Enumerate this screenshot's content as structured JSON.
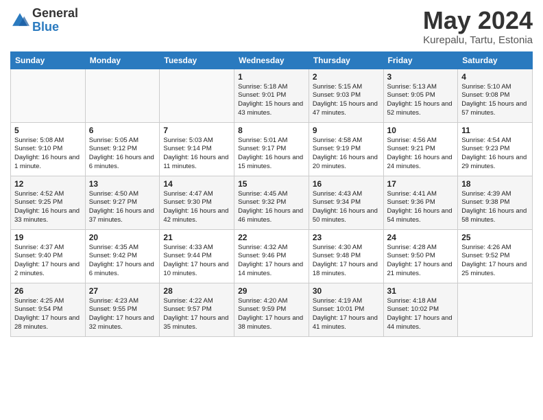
{
  "header": {
    "logo_general": "General",
    "logo_blue": "Blue",
    "title": "May 2024",
    "subtitle": "Kurepalu, Tartu, Estonia"
  },
  "days_of_week": [
    "Sunday",
    "Monday",
    "Tuesday",
    "Wednesday",
    "Thursday",
    "Friday",
    "Saturday"
  ],
  "weeks": [
    [
      {
        "num": "",
        "info": ""
      },
      {
        "num": "",
        "info": ""
      },
      {
        "num": "",
        "info": ""
      },
      {
        "num": "1",
        "info": "Sunrise: 5:18 AM\nSunset: 9:01 PM\nDaylight: 15 hours and 43 minutes."
      },
      {
        "num": "2",
        "info": "Sunrise: 5:15 AM\nSunset: 9:03 PM\nDaylight: 15 hours and 47 minutes."
      },
      {
        "num": "3",
        "info": "Sunrise: 5:13 AM\nSunset: 9:05 PM\nDaylight: 15 hours and 52 minutes."
      },
      {
        "num": "4",
        "info": "Sunrise: 5:10 AM\nSunset: 9:08 PM\nDaylight: 15 hours and 57 minutes."
      }
    ],
    [
      {
        "num": "5",
        "info": "Sunrise: 5:08 AM\nSunset: 9:10 PM\nDaylight: 16 hours and 1 minute."
      },
      {
        "num": "6",
        "info": "Sunrise: 5:05 AM\nSunset: 9:12 PM\nDaylight: 16 hours and 6 minutes."
      },
      {
        "num": "7",
        "info": "Sunrise: 5:03 AM\nSunset: 9:14 PM\nDaylight: 16 hours and 11 minutes."
      },
      {
        "num": "8",
        "info": "Sunrise: 5:01 AM\nSunset: 9:17 PM\nDaylight: 16 hours and 15 minutes."
      },
      {
        "num": "9",
        "info": "Sunrise: 4:58 AM\nSunset: 9:19 PM\nDaylight: 16 hours and 20 minutes."
      },
      {
        "num": "10",
        "info": "Sunrise: 4:56 AM\nSunset: 9:21 PM\nDaylight: 16 hours and 24 minutes."
      },
      {
        "num": "11",
        "info": "Sunrise: 4:54 AM\nSunset: 9:23 PM\nDaylight: 16 hours and 29 minutes."
      }
    ],
    [
      {
        "num": "12",
        "info": "Sunrise: 4:52 AM\nSunset: 9:25 PM\nDaylight: 16 hours and 33 minutes."
      },
      {
        "num": "13",
        "info": "Sunrise: 4:50 AM\nSunset: 9:27 PM\nDaylight: 16 hours and 37 minutes."
      },
      {
        "num": "14",
        "info": "Sunrise: 4:47 AM\nSunset: 9:30 PM\nDaylight: 16 hours and 42 minutes."
      },
      {
        "num": "15",
        "info": "Sunrise: 4:45 AM\nSunset: 9:32 PM\nDaylight: 16 hours and 46 minutes."
      },
      {
        "num": "16",
        "info": "Sunrise: 4:43 AM\nSunset: 9:34 PM\nDaylight: 16 hours and 50 minutes."
      },
      {
        "num": "17",
        "info": "Sunrise: 4:41 AM\nSunset: 9:36 PM\nDaylight: 16 hours and 54 minutes."
      },
      {
        "num": "18",
        "info": "Sunrise: 4:39 AM\nSunset: 9:38 PM\nDaylight: 16 hours and 58 minutes."
      }
    ],
    [
      {
        "num": "19",
        "info": "Sunrise: 4:37 AM\nSunset: 9:40 PM\nDaylight: 17 hours and 2 minutes."
      },
      {
        "num": "20",
        "info": "Sunrise: 4:35 AM\nSunset: 9:42 PM\nDaylight: 17 hours and 6 minutes."
      },
      {
        "num": "21",
        "info": "Sunrise: 4:33 AM\nSunset: 9:44 PM\nDaylight: 17 hours and 10 minutes."
      },
      {
        "num": "22",
        "info": "Sunrise: 4:32 AM\nSunset: 9:46 PM\nDaylight: 17 hours and 14 minutes."
      },
      {
        "num": "23",
        "info": "Sunrise: 4:30 AM\nSunset: 9:48 PM\nDaylight: 17 hours and 18 minutes."
      },
      {
        "num": "24",
        "info": "Sunrise: 4:28 AM\nSunset: 9:50 PM\nDaylight: 17 hours and 21 minutes."
      },
      {
        "num": "25",
        "info": "Sunrise: 4:26 AM\nSunset: 9:52 PM\nDaylight: 17 hours and 25 minutes."
      }
    ],
    [
      {
        "num": "26",
        "info": "Sunrise: 4:25 AM\nSunset: 9:54 PM\nDaylight: 17 hours and 28 minutes."
      },
      {
        "num": "27",
        "info": "Sunrise: 4:23 AM\nSunset: 9:55 PM\nDaylight: 17 hours and 32 minutes."
      },
      {
        "num": "28",
        "info": "Sunrise: 4:22 AM\nSunset: 9:57 PM\nDaylight: 17 hours and 35 minutes."
      },
      {
        "num": "29",
        "info": "Sunrise: 4:20 AM\nSunset: 9:59 PM\nDaylight: 17 hours and 38 minutes."
      },
      {
        "num": "30",
        "info": "Sunrise: 4:19 AM\nSunset: 10:01 PM\nDaylight: 17 hours and 41 minutes."
      },
      {
        "num": "31",
        "info": "Sunrise: 4:18 AM\nSunset: 10:02 PM\nDaylight: 17 hours and 44 minutes."
      },
      {
        "num": "",
        "info": ""
      }
    ]
  ]
}
